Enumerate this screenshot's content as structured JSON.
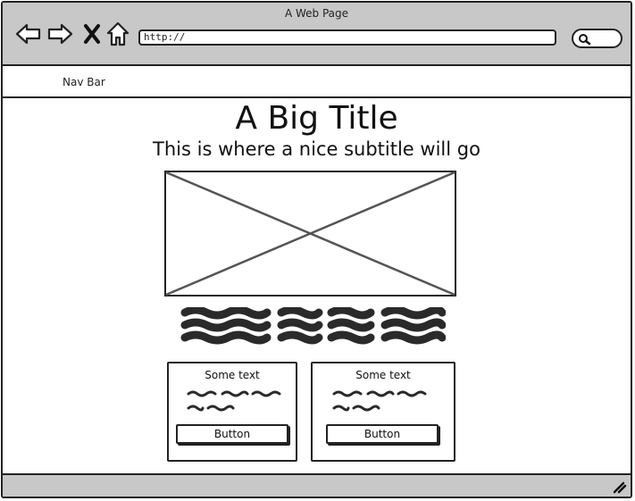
{
  "window": {
    "title": "A Web Page"
  },
  "toolbar": {
    "back_icon": "back-arrow-icon",
    "forward_icon": "forward-arrow-icon",
    "stop_icon": "close-x-icon",
    "home_icon": "home-icon",
    "url_value": "http://",
    "search_icon": "search-icon"
  },
  "navbar": {
    "label": "Nav Bar"
  },
  "main": {
    "title": "A Big Title",
    "subtitle": "This is where a nice subtitle will go",
    "image": "image-placeholder"
  },
  "cards": [
    {
      "title": "Some text",
      "button_label": "Button"
    },
    {
      "title": "Some text",
      "button_label": "Button"
    }
  ],
  "colors": {
    "chrome": "#c8c8c8",
    "border": "#222222",
    "scribble": "#2a2a2a"
  }
}
